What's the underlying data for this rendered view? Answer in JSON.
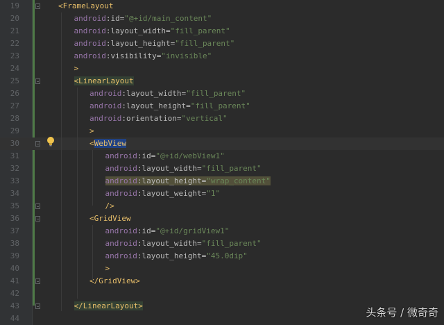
{
  "editor": {
    "lines": [
      {
        "num": "19",
        "indent": 0,
        "parts": [
          [
            "punct",
            "<"
          ],
          [
            "tag",
            "FrameLayout"
          ]
        ]
      },
      {
        "num": "20",
        "indent": 1,
        "parts": [
          [
            "ns",
            "android"
          ],
          [
            "attr",
            ":id="
          ],
          [
            "val",
            "\"@+id/main_content\""
          ]
        ]
      },
      {
        "num": "21",
        "indent": 1,
        "parts": [
          [
            "ns",
            "android"
          ],
          [
            "attr",
            ":layout_width="
          ],
          [
            "val",
            "\"fill_parent\""
          ]
        ]
      },
      {
        "num": "22",
        "indent": 1,
        "parts": [
          [
            "ns",
            "android"
          ],
          [
            "attr",
            ":layout_height="
          ],
          [
            "val",
            "\"fill_parent\""
          ]
        ]
      },
      {
        "num": "23",
        "indent": 1,
        "parts": [
          [
            "ns",
            "android"
          ],
          [
            "attr",
            ":visibility="
          ],
          [
            "val",
            "\"invisible\""
          ]
        ]
      },
      {
        "num": "24",
        "indent": 1,
        "parts": [
          [
            "punct",
            ">"
          ]
        ]
      },
      {
        "num": "25",
        "indent": 1,
        "parts": [
          [
            "punct hl-tag",
            "<"
          ],
          [
            "tag hl-tag",
            "LinearLayout"
          ]
        ]
      },
      {
        "num": "26",
        "indent": 2,
        "parts": [
          [
            "ns",
            "android"
          ],
          [
            "attr",
            ":layout_width="
          ],
          [
            "val",
            "\"fill_parent\""
          ]
        ]
      },
      {
        "num": "27",
        "indent": 2,
        "parts": [
          [
            "ns",
            "android"
          ],
          [
            "attr",
            ":layout_height="
          ],
          [
            "val",
            "\"fill_parent\""
          ]
        ]
      },
      {
        "num": "28",
        "indent": 2,
        "parts": [
          [
            "ns",
            "android"
          ],
          [
            "attr",
            ":orientation="
          ],
          [
            "val",
            "\"vertical\""
          ]
        ]
      },
      {
        "num": "29",
        "indent": 2,
        "parts": [
          [
            "punct",
            ">"
          ]
        ]
      },
      {
        "num": "30",
        "indent": 2,
        "parts": [
          [
            "punct",
            "<"
          ],
          [
            "tag hl-sel",
            "WebView"
          ]
        ],
        "current": true
      },
      {
        "num": "31",
        "indent": 3,
        "parts": [
          [
            "ns",
            "android"
          ],
          [
            "attr",
            ":id="
          ],
          [
            "val",
            "\"@+id/webView1\""
          ]
        ]
      },
      {
        "num": "32",
        "indent": 3,
        "parts": [
          [
            "ns",
            "android"
          ],
          [
            "attr",
            ":layout_width="
          ],
          [
            "val",
            "\"fill_parent\""
          ]
        ]
      },
      {
        "num": "33",
        "indent": 3,
        "parts": [
          [
            "ns hl-warn",
            "android"
          ],
          [
            "attr hl-warn",
            ":layout_height="
          ],
          [
            "val hl-warn",
            "\"wrap_content\""
          ]
        ]
      },
      {
        "num": "34",
        "indent": 3,
        "parts": [
          [
            "ns",
            "android"
          ],
          [
            "attr",
            ":layout_weight="
          ],
          [
            "val",
            "\"1\""
          ]
        ]
      },
      {
        "num": "35",
        "indent": 3,
        "parts": [
          [
            "punct",
            "/>"
          ]
        ]
      },
      {
        "num": "36",
        "indent": 2,
        "parts": [
          [
            "punct",
            "<"
          ],
          [
            "tag",
            "GridView"
          ]
        ]
      },
      {
        "num": "37",
        "indent": 3,
        "parts": [
          [
            "ns",
            "android"
          ],
          [
            "attr",
            ":id="
          ],
          [
            "val",
            "\"@+id/gridView1\""
          ]
        ]
      },
      {
        "num": "38",
        "indent": 3,
        "parts": [
          [
            "ns",
            "android"
          ],
          [
            "attr",
            ":layout_width="
          ],
          [
            "val",
            "\"fill_parent\""
          ]
        ]
      },
      {
        "num": "39",
        "indent": 3,
        "parts": [
          [
            "ns",
            "android"
          ],
          [
            "attr",
            ":layout_height="
          ],
          [
            "val",
            "\"45.0dip\""
          ]
        ]
      },
      {
        "num": "40",
        "indent": 3,
        "parts": [
          [
            "punct",
            ">"
          ]
        ]
      },
      {
        "num": "41",
        "indent": 2,
        "parts": [
          [
            "punct",
            "</"
          ],
          [
            "tag",
            "GridView"
          ],
          [
            "punct",
            ">"
          ]
        ]
      },
      {
        "num": "42",
        "indent": 0,
        "parts": []
      },
      {
        "num": "43",
        "indent": 1,
        "parts": [
          [
            "punct hl-tag",
            "</"
          ],
          [
            "tag hl-tag",
            "LinearLayout"
          ],
          [
            "punct hl-tag",
            ">"
          ]
        ]
      },
      {
        "num": "44",
        "indent": 0,
        "parts": []
      }
    ]
  },
  "watermark": "头条号 / 微奇奇",
  "colors": {
    "background": "#2b2b2b",
    "gutter": "#313335",
    "tag": "#e8bf6a",
    "namespace": "#9876aa",
    "value": "#6a8759",
    "selection": "#214283"
  },
  "icons": {
    "intention": "lightbulb-icon"
  }
}
